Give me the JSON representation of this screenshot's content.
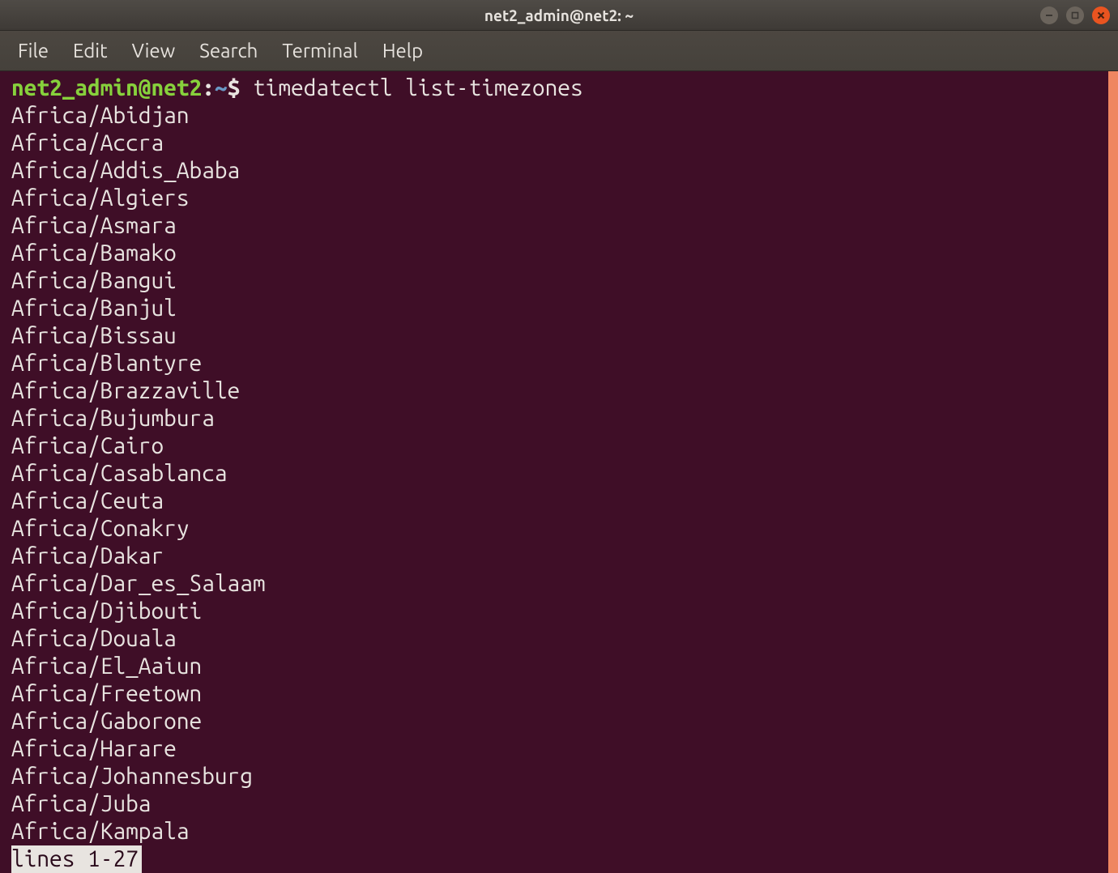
{
  "colors": {
    "bg": "#3f0e27",
    "chrome": "#45413b",
    "text": "#e8e4e0",
    "prompt_user": "#87d13c",
    "prompt_path": "#6a98c4",
    "close": "#e95420",
    "scrollbar": "#ef8661"
  },
  "titlebar": {
    "title": "net2_admin@net2: ~"
  },
  "menubar": {
    "items": [
      "File",
      "Edit",
      "View",
      "Search",
      "Terminal",
      "Help"
    ]
  },
  "prompt": {
    "user_host": "net2_admin@net2",
    "separator": ":",
    "path": "~",
    "sigil": "$"
  },
  "command": "timedatectl list-timezones",
  "output_lines": [
    "Africa/Abidjan",
    "Africa/Accra",
    "Africa/Addis_Ababa",
    "Africa/Algiers",
    "Africa/Asmara",
    "Africa/Bamako",
    "Africa/Bangui",
    "Africa/Banjul",
    "Africa/Bissau",
    "Africa/Blantyre",
    "Africa/Brazzaville",
    "Africa/Bujumbura",
    "Africa/Cairo",
    "Africa/Casablanca",
    "Africa/Ceuta",
    "Africa/Conakry",
    "Africa/Dakar",
    "Africa/Dar_es_Salaam",
    "Africa/Djibouti",
    "Africa/Douala",
    "Africa/El_Aaiun",
    "Africa/Freetown",
    "Africa/Gaborone",
    "Africa/Harare",
    "Africa/Johannesburg",
    "Africa/Juba",
    "Africa/Kampala"
  ],
  "status_line": "lines 1-27"
}
